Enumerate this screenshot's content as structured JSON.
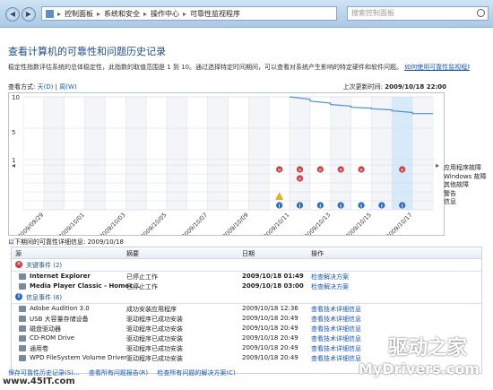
{
  "titlebar": {
    "breadcrumb": [
      "控制面板",
      "系统和安全",
      "操作中心",
      "可靠性监视程序"
    ],
    "search_placeholder": "搜索控制面板"
  },
  "page": {
    "title": "查看计算机的可靠性和问题历史记录",
    "description": "稳定性指数评估系统的总体稳定性，此指数的取值范围是 1 到 10。通过选择特定时间期间，可以查看对系统产生影响的特定硬件和软件问题。",
    "description_link": "如何使用可靠性监视程序。",
    "view_by_label": "查看方式:",
    "view_day": "天(D)",
    "view_week": "周(W)",
    "last_update_label": "上次更新时间:",
    "last_update_value": "2009/10/18 22:00"
  },
  "chart_data": {
    "type": "line",
    "x": [
      "2009/09/29",
      "2009/09/30",
      "2009/10/01",
      "2009/10/02",
      "2009/10/03",
      "2009/10/04",
      "2009/10/05",
      "2009/10/06",
      "2009/10/07",
      "2009/10/08",
      "2009/10/09",
      "2009/10/10",
      "2009/10/11",
      "2009/10/12",
      "2009/10/13",
      "2009/10/14",
      "2009/10/15",
      "2009/10/16",
      "2009/10/17",
      "2009/10/18"
    ],
    "x_tick_labels": [
      "2009/09/29",
      "2009/10/01",
      "2009/10/03",
      "2009/10/05",
      "2009/10/07",
      "2009/10/09",
      "2009/10/11",
      "2009/10/13",
      "2009/10/15",
      "2009/10/17"
    ],
    "y_ticks": [
      "10",
      "5",
      "1"
    ],
    "ylim": [
      1,
      10
    ],
    "series": [
      {
        "values": [
          null,
          null,
          null,
          null,
          null,
          null,
          null,
          null,
          null,
          null,
          null,
          null,
          null,
          10,
          9.4,
          8.9,
          8.5,
          8.3,
          8.0,
          7.6
        ]
      }
    ],
    "event_rows": [
      "应用程序故障",
      "Windows 故障",
      "其他故障",
      "警告",
      "信息"
    ],
    "app_failure_days": [
      13,
      14,
      15,
      16,
      17,
      19
    ],
    "windows_failure_days": [
      14
    ],
    "warning_days": [
      13
    ],
    "info_days": [
      13,
      14,
      15,
      16,
      17,
      18,
      19
    ],
    "selected_day": 19
  },
  "history": {
    "title": "以下期间的可靠性详细信息: 2009/10/18",
    "headers": [
      "源",
      "摘要",
      "日期",
      "操作"
    ],
    "critical_group": "关键事件 (2)",
    "critical": [
      {
        "source": "Internet Explorer",
        "summary": "已停止工作",
        "date": "2009/10/18 01:49",
        "action": "检查解决方案"
      },
      {
        "source": "Media Player Classic - Homec...",
        "summary": "已停止工作",
        "date": "2009/10/18 03:00",
        "action": "检查解决方案"
      }
    ],
    "info_group": "信息事件 (6)",
    "info": [
      {
        "source": "Adobe Audition 3.0",
        "summary": "成功安装应用程序",
        "date": "2009/10/18 12:36",
        "action": "查看技术详细信息"
      },
      {
        "source": "USB 大容量存储设备",
        "summary": "驱动程序已成功安装",
        "date": "2009/10/18 20:49",
        "action": "查看技术详细信息"
      },
      {
        "source": "磁盘驱动器",
        "summary": "驱动程序已成功安装",
        "date": "2009/10/18 20:49",
        "action": "查看技术详细信息"
      },
      {
        "source": "CD-ROM Drive",
        "summary": "驱动程序已成功安装",
        "date": "2009/10/18 20:49",
        "action": "查看技术详细信息"
      },
      {
        "source": "通用卷",
        "summary": "驱动程序已成功安装",
        "date": "2009/10/18 20:49",
        "action": "查看技术详细信息"
      },
      {
        "source": "WPD FileSystem Volume Driver",
        "summary": "驱动程序已成功安装",
        "date": "2009/10/18 20:49",
        "action": "查看技术详细信息"
      }
    ]
  },
  "footer": {
    "save": "保存可靠性历史记录(S)...",
    "all_reports": "查看所有问题报告(R)",
    "check_all": "检查所有问题的解决方案(C)"
  },
  "watermark": {
    "left": "www.45IT.com",
    "right_cn": "驱动之家",
    "right_en": "MyDrivers.com"
  },
  "colors": {
    "accent": "#1a55b4",
    "line": "#4a90d0",
    "error": "#d23b3b",
    "warning": "#e8b900",
    "info": "#2a6bbf"
  }
}
